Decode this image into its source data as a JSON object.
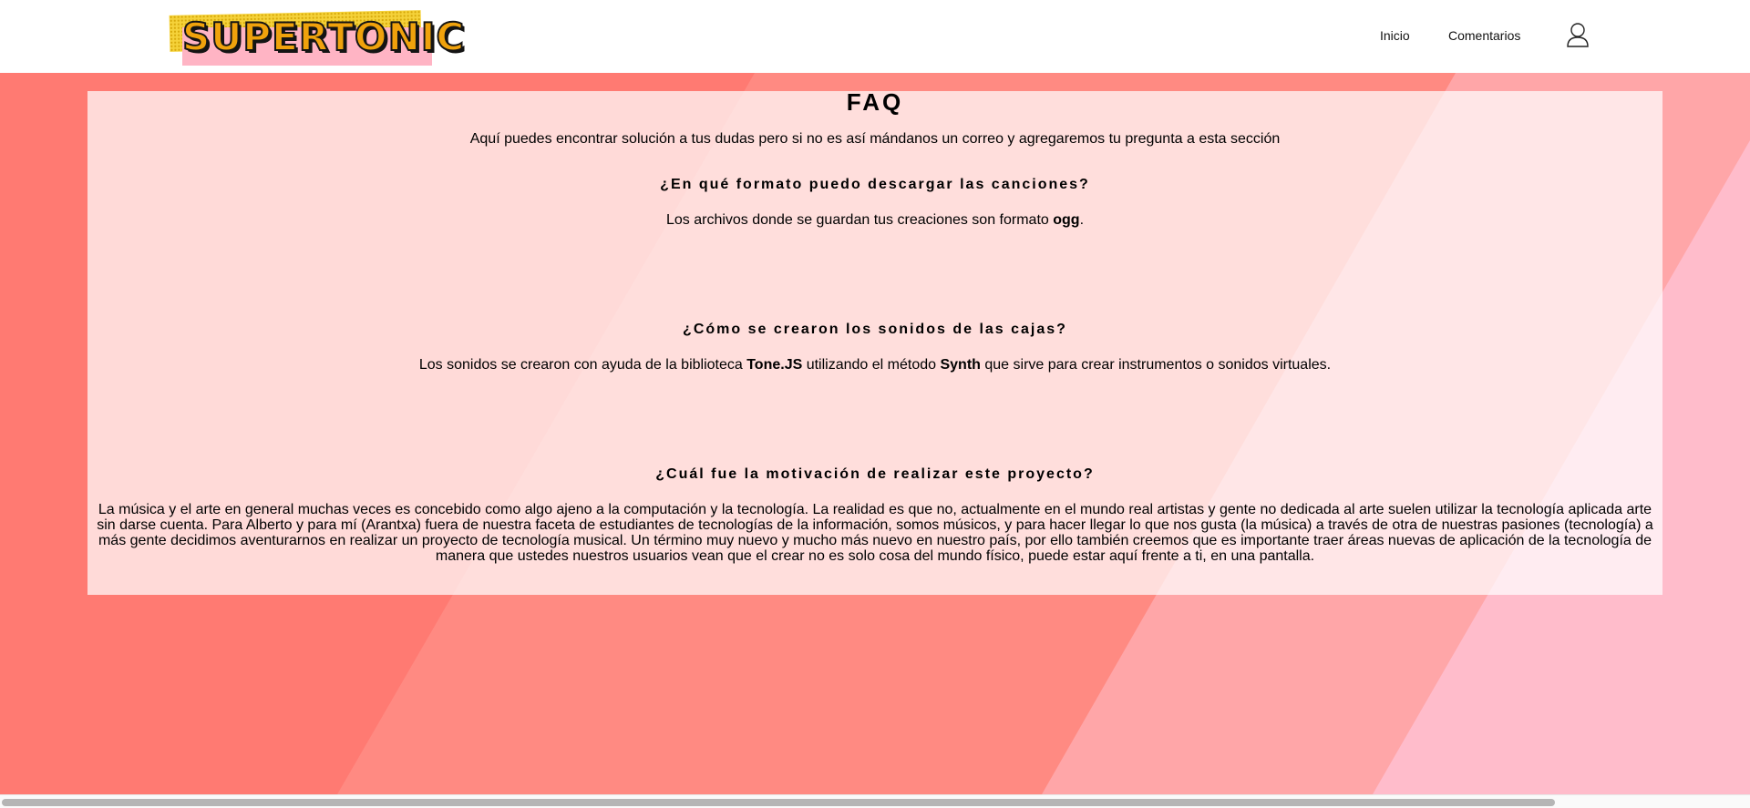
{
  "header": {
    "logo_text": "SUPERTONIC",
    "nav": [
      {
        "label": "Inicio"
      },
      {
        "label": "Comentarios"
      }
    ],
    "user_icon": "user-icon"
  },
  "faq": {
    "title": "FAQ",
    "intro": "Aquí puedes encontrar solución a tus dudas pero si no es así mándanos un correo y agregaremos tu pregunta a esta sección",
    "items": [
      {
        "question": "¿En qué formato puedo descargar las canciones?",
        "answer_before": "Los archivos donde se guardan tus creaciones son formato ",
        "answer_bold": "ogg",
        "answer_after": "."
      },
      {
        "question": "¿Cómo se crearon los sonidos de las cajas?",
        "answer_part1": "Los sonidos se crearon con ayuda de la biblioteca ",
        "answer_bold1": "Tone.JS",
        "answer_part2": " utilizando el método ",
        "answer_bold2": "Synth",
        "answer_part3": " que sirve para crear instrumentos o sonidos virtuales."
      },
      {
        "question": "¿Cuál fue la motivación de realizar este proyecto?",
        "answer": "La música y el arte en general muchas veces es concebido como algo ajeno a la computación y la tecnología. La realidad es que no, actualmente en el mundo real artistas y gente no dedicada al arte suelen utilizar la tecnología aplicada arte sin darse cuenta. Para Alberto y para mí (Arantxa) fuera de nuestra faceta de estudiantes de tecnologías de la información, somos músicos, y para hacer llegar lo que nos gusta (la música) a través de otra de nuestras pasiones (tecnología) a más gente decidimos aventurarnos en realizar un proyecto de tecnología musical. Un término muy nuevo y mucho más nuevo en nuestro país, por ello también creemos que es importante traer áreas nuevas de aplicación de la tecnología de manera que ustedes nuestros usuarios vean que el crear no es solo cosa del mundo físico, puede estar aquí frente a ti, en una pantalla."
      }
    ]
  },
  "colors": {
    "background_base": "#ff7a72",
    "stripe_mid": "#ff8a82",
    "stripe_light": "#ffa6a8",
    "stripe_pink": "#ffbccb",
    "logo_yellow": "#f5d23a",
    "logo_pink": "#ffb4c4"
  }
}
